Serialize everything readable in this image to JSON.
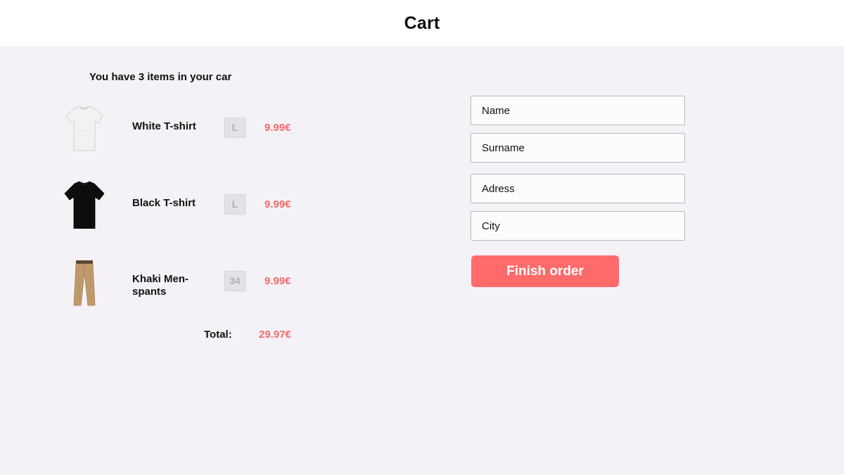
{
  "header": {
    "title": "Cart"
  },
  "cart": {
    "summary": "You have 3 items in your car",
    "items": [
      {
        "name": "White T-shirt",
        "size": "L",
        "price": "9.99€",
        "icon": "white-tshirt-image"
      },
      {
        "name": "Black T-shirt",
        "size": "L",
        "price": "9.99€",
        "icon": "black-tshirt-image"
      },
      {
        "name": "Khaki Men-spants",
        "size": "34",
        "price": "9.99€",
        "icon": "khaki-pants-image"
      }
    ],
    "total_label": "Total:",
    "total_value": "29.97€"
  },
  "form": {
    "name_placeholder": "Name",
    "surname_placeholder": "Surname",
    "address_placeholder": "Adress",
    "city_placeholder": "City",
    "submit_label": "Finish order"
  },
  "colors": {
    "accent": "#ff6b6b",
    "price": "#f26b6b",
    "background": "#f4f2f7",
    "header": "#ffffff"
  }
}
